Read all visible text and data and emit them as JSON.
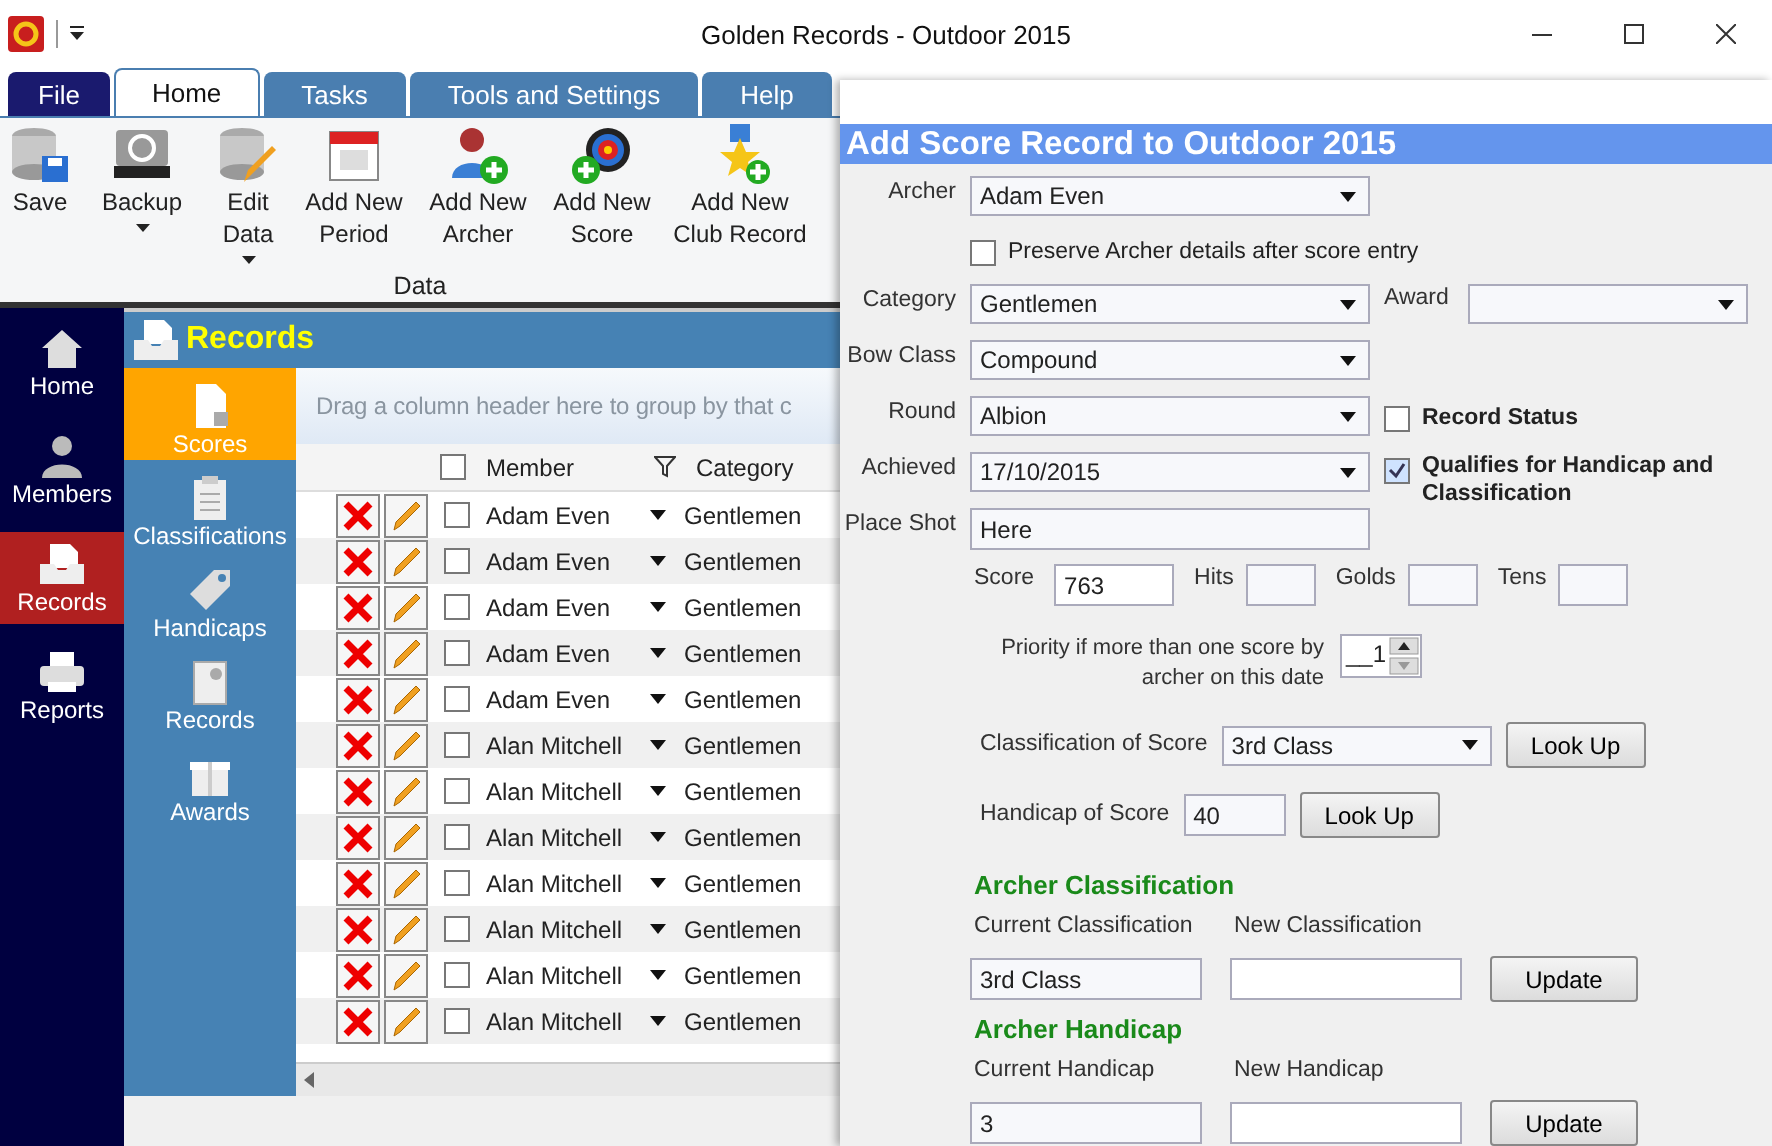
{
  "window": {
    "title": "Golden Records - Outdoor 2015"
  },
  "tabs": [
    {
      "label": "File",
      "kind": "file",
      "selected": false
    },
    {
      "label": "Home",
      "kind": "tab",
      "selected": true
    },
    {
      "label": "Tasks",
      "kind": "tab",
      "selected": false
    },
    {
      "label": "Tools and Settings",
      "kind": "tab",
      "selected": false
    },
    {
      "label": "Help",
      "kind": "tab",
      "selected": false
    }
  ],
  "ribbon": {
    "group": "Data",
    "buttons": [
      {
        "label": "Save",
        "dropdown": false
      },
      {
        "label": "Backup",
        "dropdown": true
      },
      {
        "label": "Edit Data",
        "dropdown": true
      },
      {
        "label": "Add New Period",
        "dropdown": false
      },
      {
        "label": "Add New Archer",
        "dropdown": false
      },
      {
        "label": "Add New Score",
        "dropdown": false
      },
      {
        "label": "Add New Club Record",
        "dropdown": false
      }
    ]
  },
  "nav": [
    {
      "label": "Home",
      "selected": false
    },
    {
      "label": "Members",
      "selected": false
    },
    {
      "label": "Records",
      "selected": true
    },
    {
      "label": "Reports",
      "selected": false
    }
  ],
  "section": {
    "title": "Records"
  },
  "subnav": [
    {
      "label": "Scores",
      "selected": true
    },
    {
      "label": "Classifications",
      "selected": false
    },
    {
      "label": "Handicaps",
      "selected": false
    },
    {
      "label": "Records",
      "selected": false
    },
    {
      "label": "Awards",
      "selected": false
    }
  ],
  "grid": {
    "group_hint": "Drag a column header here to group by that c",
    "all_checked": false,
    "columns": [
      "Member",
      "Category"
    ],
    "rows": [
      {
        "member": "Adam Even",
        "category": "Gentlemen",
        "checked": false
      },
      {
        "member": "Adam Even",
        "category": "Gentlemen",
        "checked": false
      },
      {
        "member": "Adam Even",
        "category": "Gentlemen",
        "checked": false
      },
      {
        "member": "Adam Even",
        "category": "Gentlemen",
        "checked": false
      },
      {
        "member": "Adam Even",
        "category": "Gentlemen",
        "checked": false
      },
      {
        "member": "Alan Mitchell",
        "category": "Gentlemen",
        "checked": false
      },
      {
        "member": "Alan Mitchell",
        "category": "Gentlemen",
        "checked": false
      },
      {
        "member": "Alan Mitchell",
        "category": "Gentlemen",
        "checked": false
      },
      {
        "member": "Alan Mitchell",
        "category": "Gentlemen",
        "checked": false
      },
      {
        "member": "Alan Mitchell",
        "category": "Gentlemen",
        "checked": false
      },
      {
        "member": "Alan Mitchell",
        "category": "Gentlemen",
        "checked": false
      },
      {
        "member": "Alan Mitchell",
        "category": "Gentlemen",
        "checked": false
      }
    ]
  },
  "dialog": {
    "title": "Add Score Record to Outdoor 2015",
    "archer": {
      "label": "Archer",
      "value": "Adam Even"
    },
    "preserve": {
      "label": "Preserve Archer details after score entry",
      "checked": false
    },
    "category": {
      "label": "Category",
      "value": "Gentlemen"
    },
    "award": {
      "label": "Award"
    },
    "bow_class": {
      "label": "Bow Class",
      "value": "Compound"
    },
    "round": {
      "label": "Round",
      "value": "Albion"
    },
    "record_status": {
      "label": "Record Status",
      "checked": false
    },
    "achieved": {
      "label": "Achieved",
      "value": "17/10/2015"
    },
    "qualifies": {
      "label": "Qualifies for Handicap and Classification",
      "checked": true
    },
    "place_shot": {
      "label": "Place Shot",
      "value": "Here"
    },
    "score_fields": [
      {
        "label": "Score",
        "value": "763"
      },
      {
        "label": "Hits"
      },
      {
        "label": "Golds"
      },
      {
        "label": "Tens"
      }
    ],
    "priority": {
      "label": "Priority if more than one score by archer on this date",
      "value": "__1"
    },
    "classification_of_score": {
      "label": "Classification of Score",
      "value": "3rd Class",
      "button": "Look Up"
    },
    "handicap_of_score": {
      "label": "Handicap of Score",
      "value": "40",
      "button": "Look Up"
    },
    "sections": [
      {
        "heading": "Archer Classification",
        "current_label": "Current Classification",
        "current": "3rd Class",
        "new_label": "New Classification",
        "button": "Update"
      },
      {
        "heading": "Archer Handicap",
        "current_label": "Current Handicap",
        "current": "3",
        "new_label": "New Handicap",
        "button": "Update"
      }
    ]
  }
}
